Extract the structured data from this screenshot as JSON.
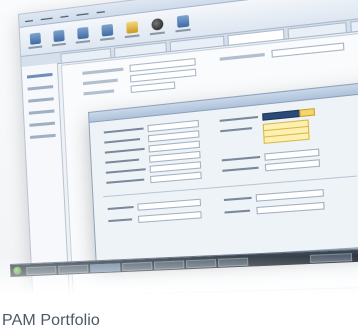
{
  "caption": "PAM Portfolio",
  "colors": {
    "caption_text": "#4e5864",
    "ribbon": "#dde6f1",
    "dialog_title": "#aec2da",
    "selected_field": "#2b4a78",
    "highlight_field": "#fdf0b0",
    "taskbar": "#20262d"
  },
  "icons": [
    "folder-icon",
    "save-icon",
    "document-icon",
    "chart-icon",
    "tools-icon",
    "record-icon",
    "user-icon",
    "start-orb-icon"
  ]
}
